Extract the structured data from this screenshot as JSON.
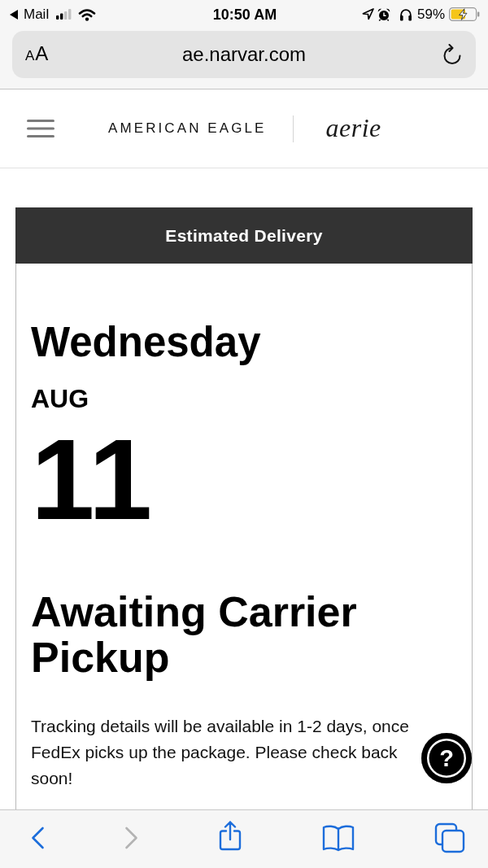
{
  "status_bar": {
    "back_label": "Mail",
    "time": "10:50 AM",
    "battery_percent": "59%"
  },
  "address_bar": {
    "text_size_button": "AA",
    "url": "ae.narvar.com"
  },
  "site_header": {
    "brand": "AMERICAN EAGLE",
    "sub_brand": "aerie"
  },
  "delivery_card": {
    "title": "Estimated Delivery",
    "weekday": "Wednesday",
    "month": "AUG",
    "day": "11",
    "status": "Awaiting Carrier Pickup",
    "message": "Tracking details will be available in 1-2 days, once FedEx picks up the package. Please check back soon!"
  },
  "help_button": {
    "label": "?"
  },
  "toolbar": {
    "buttons": [
      {
        "kind": "back",
        "disabled": false
      },
      {
        "kind": "forward",
        "disabled": true
      },
      {
        "kind": "share",
        "disabled": false
      },
      {
        "kind": "bookmarks",
        "disabled": false
      },
      {
        "kind": "tabs",
        "disabled": false
      }
    ]
  }
}
